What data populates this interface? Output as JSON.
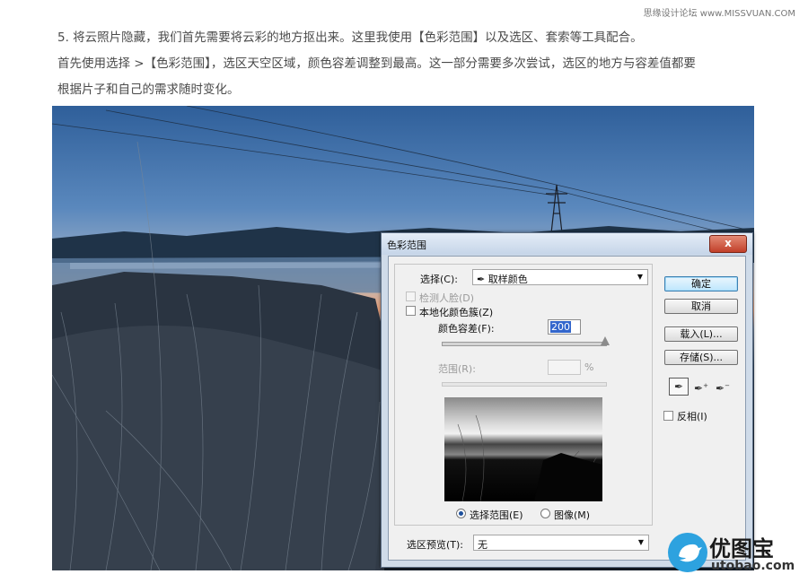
{
  "watermark": "思缘设计论坛 www.MISSVUAN.COM",
  "article": {
    "line1": "5. 将云照片隐藏，我们首先需要将云彩的地方抠出来。这里我使用【色彩范围】以及选区、套索等工具配合。",
    "line2": "首先使用选择 >【色彩范围】，选区天空区域，颜色容差调整到最高。这一部分需要多次尝试，选区的地方与容差值都要",
    "line3": "根据片子和自己的需求随时变化。"
  },
  "dialog": {
    "title": "色彩范围",
    "close_glyph": "x",
    "select_label": "选择(C):",
    "select_value": "取样颜色",
    "detect_faces_label": "检测人脸(D)",
    "localized_clusters_label": "本地化颜色簇(Z)",
    "fuzziness_label": "颜色容差(F):",
    "fuzziness_value": "200",
    "fuzziness_fraction": 1.0,
    "range_label": "范围(R):",
    "range_unit": "%",
    "radio_selection_label": "选择范围(E)",
    "radio_image_label": "图像(M)",
    "preview_label": "选区预览(T):",
    "preview_value": "无",
    "ok_label": "确定",
    "cancel_label": "取消",
    "load_label": "载入(L)...",
    "save_label": "存储(S)...",
    "invert_label": "反相(I)",
    "tool_icons": [
      "eyedropper-icon",
      "eyedropper-plus-icon",
      "eyedropper-minus-icon"
    ]
  },
  "logo": {
    "title": "优图宝",
    "subtitle": "utobao.com"
  }
}
